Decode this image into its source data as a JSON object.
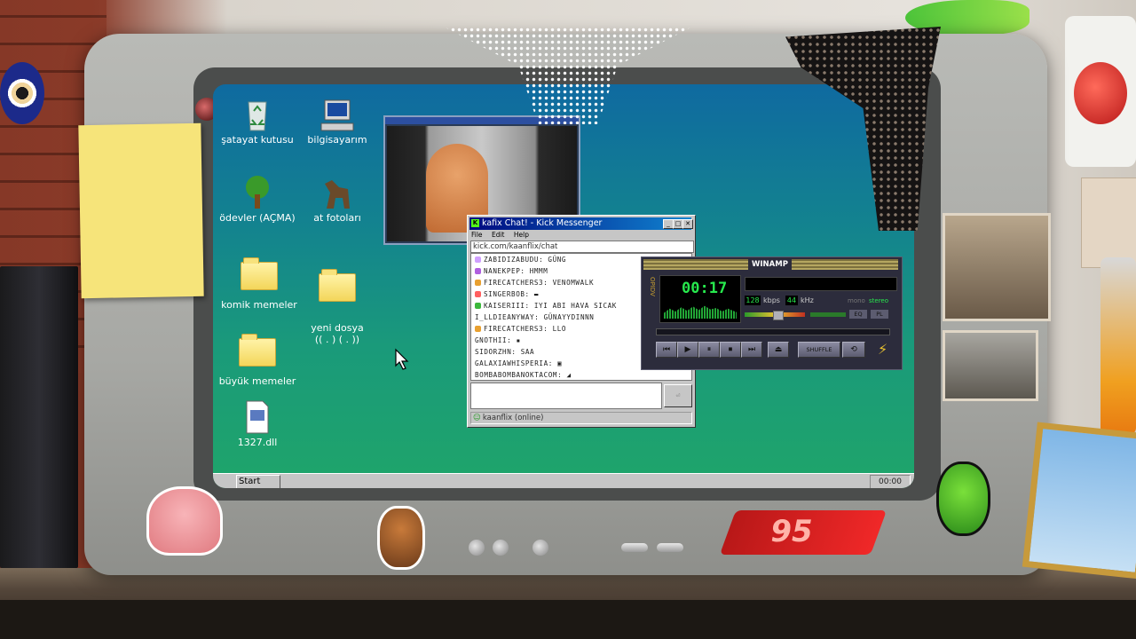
{
  "desktop": {
    "icons": [
      {
        "label": "şatayat kutusu",
        "icon": "recycle-bin-icon"
      },
      {
        "label": "bilgisayarım",
        "icon": "computer-icon"
      },
      {
        "label": "ödevler (AÇMA)",
        "icon": "tree-icon"
      },
      {
        "label": "at fotoları",
        "icon": "horse-icon"
      },
      {
        "label": "komik memeler",
        "icon": "folder-icon"
      },
      {
        "label": "yeni dosya\n(( . ) ( . ))",
        "icon": "folder-icon"
      },
      {
        "label": "büyük memeler",
        "icon": "folder-icon"
      },
      {
        "label": "1327.dll",
        "icon": "dll-file-icon"
      }
    ],
    "taskbar": {
      "start_label": "Start",
      "clock": "00:00"
    }
  },
  "messenger": {
    "title": "kafix Chat! - Kick Messenger",
    "menu": [
      "File",
      "Edit",
      "Help"
    ],
    "url": "kick.com/kaanflix/chat",
    "messages": [
      {
        "user": "ZABIDIZABUDU",
        "text": "GÜNG",
        "badge_color": "#d0a0ff"
      },
      {
        "user": "NANEKPEP",
        "text": "HMMM",
        "badge_color": "#b060e0"
      },
      {
        "user": "FIRECATCHERS3",
        "text": "VENOMWALK",
        "badge_color": "#e8a030"
      },
      {
        "user": "SINGERBOB",
        "text": "▬",
        "badge_color": "#ff6060"
      },
      {
        "user": "KAISERIII",
        "text": "IYI ABI HAVA SICAK",
        "badge_color": "#3cb83c"
      },
      {
        "user": "I_LLDIEANYWAY",
        "text": "GÜNAYYDINNN",
        "badge_color": ""
      },
      {
        "user": "FIRECATCHERS3",
        "text": "LLO",
        "badge_color": "#e8a030"
      },
      {
        "user": "GNOTHII",
        "text": "▪",
        "badge_color": ""
      },
      {
        "user": "SIDORZHN",
        "text": "SAA",
        "badge_color": ""
      },
      {
        "user": "GALAXIAWHISPERIA",
        "text": "▣",
        "badge_color": ""
      },
      {
        "user": "BOMBABOMBANOKTACOM",
        "text": "◢",
        "badge_color": ""
      }
    ],
    "input_placeholder": "",
    "send_label": "⏎",
    "status": "kaanflix (online)"
  },
  "winamp": {
    "title": "WINAMP",
    "time": "00:17",
    "kbps": "128",
    "kbps_label": "kbps",
    "khz": "44",
    "khz_label": "kHz",
    "mono_label": "mono",
    "stereo_label": "stereo",
    "eq_label": "EQ",
    "pl_label": "PL",
    "side_label": "OPIDV",
    "shuffle_label": "SHUFFLE",
    "controls": [
      "⏮",
      "▶",
      "⏸",
      "⏹",
      "⏭",
      "⏏"
    ],
    "seek_progress": 0.0,
    "volume_level": 0.55
  },
  "tv": {
    "brand_sticker": "95"
  }
}
